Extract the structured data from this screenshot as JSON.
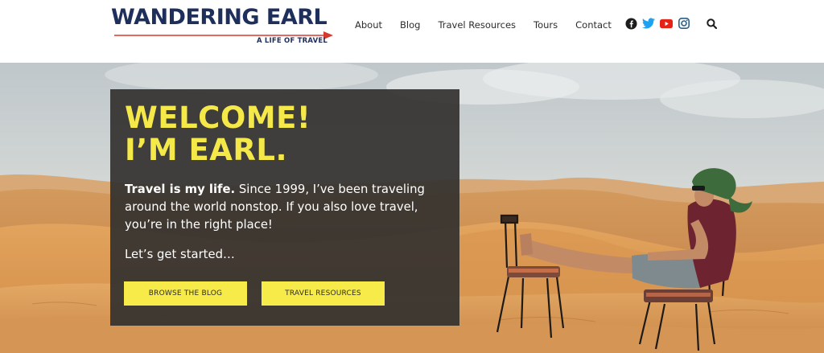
{
  "logo": {
    "title": "WANDERING EARL",
    "tagline": "A LIFE OF TRAVEL"
  },
  "nav": {
    "items": [
      "About",
      "Blog",
      "Travel Resources",
      "Tours",
      "Contact"
    ]
  },
  "social": {
    "icons": [
      "facebook-icon",
      "twitter-icon",
      "youtube-icon",
      "instagram-icon"
    ]
  },
  "search": {
    "icon": "search-icon"
  },
  "hero": {
    "title_line1": "WELCOME!",
    "title_line2": "I’M EARL.",
    "intro_bold": "Travel is my life.",
    "intro_rest": " Since 1999, I’ve been traveling around the world nonstop. If you also love travel, you’re in the right place!",
    "cta_text": "Let’s get started…",
    "buttons": {
      "blog": "BROWSE THE BLOG",
      "resources": "TRAVEL RESOURCES"
    }
  },
  "colors": {
    "brand_navy": "#1f2f5c",
    "accent_red": "#d63a2f",
    "accent_yellow": "#f5e94a",
    "panel_bg": "#33312f"
  }
}
